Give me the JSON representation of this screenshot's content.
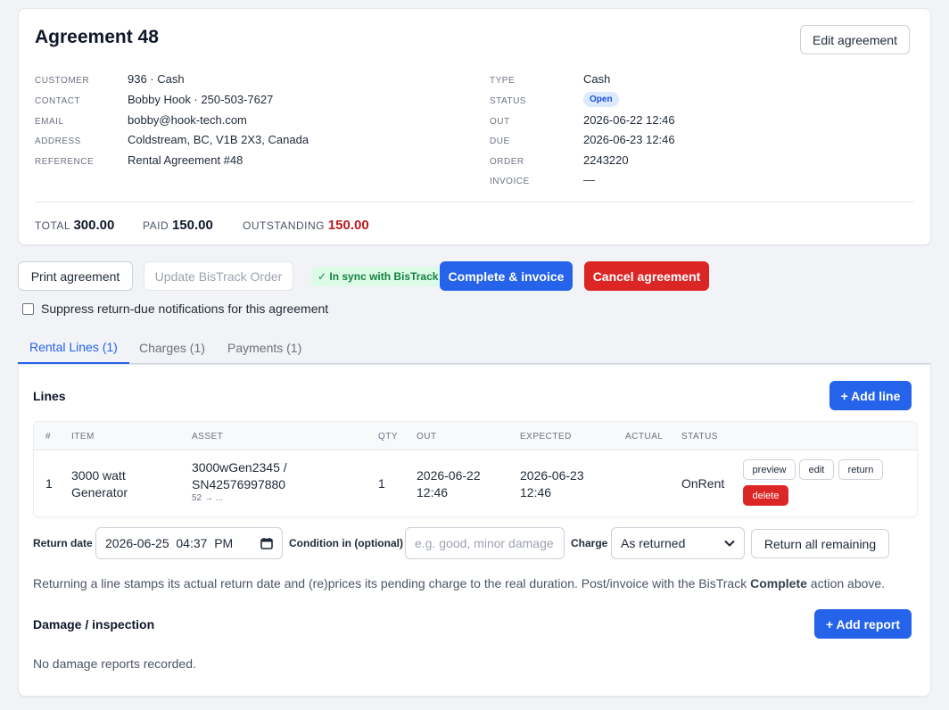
{
  "agreement": {
    "title": "Agreement 48",
    "edit_label": "Edit agreement",
    "left_fields": [
      {
        "label": "CUSTOMER",
        "value": "936 · Cash"
      },
      {
        "label": "CONTACT",
        "value": "Bobby Hook · 250-503-7627"
      },
      {
        "label": "EMAIL",
        "value": "bobby@hook-tech.com"
      },
      {
        "label": "ADDRESS",
        "value": "Coldstream, BC, V1B 2X3, Canada"
      },
      {
        "label": "REFERENCE",
        "value": "Rental Agreement #48"
      }
    ],
    "right_fields": [
      {
        "label": "TYPE",
        "value": "Cash"
      },
      {
        "label": "STATUS",
        "value": "Open"
      },
      {
        "label": "OUT",
        "value": "2026-06-22 12:46"
      },
      {
        "label": "DUE",
        "value": "2026-06-23 12:46"
      },
      {
        "label": "ORDER",
        "value": "2243220"
      },
      {
        "label": "INVOICE",
        "value": "—"
      }
    ],
    "totals": {
      "total_label": "TOTAL",
      "total": "300.00",
      "paid_label": "PAID",
      "paid": "150.00",
      "outstanding_label": "OUTSTANDING",
      "outstanding": "150.00"
    }
  },
  "actions": {
    "print": "Print agreement",
    "update_bistrack": "Update BisTrack Order",
    "sync_status": "✓ In sync with BisTrack",
    "complete": "Complete & invoice",
    "cancel": "Cancel agreement"
  },
  "suppress_label": "Suppress return-due notifications for this agreement",
  "tabs": [
    {
      "label": "Rental Lines (1)",
      "active": true
    },
    {
      "label": "Charges (1)",
      "active": false
    },
    {
      "label": "Payments (1)",
      "active": false
    }
  ],
  "lines": {
    "title": "Lines",
    "add_label": "+ Add line",
    "headers": [
      "#",
      "ITEM",
      "ASSET",
      "QTY",
      "OUT",
      "EXPECTED",
      "ACTUAL",
      "STATUS"
    ],
    "rows": [
      {
        "num": "1",
        "item_line1": "3000 watt",
        "item_line2": "Generator",
        "asset_line1": "3000wGen2345 /",
        "asset_line2": "SN42576997880",
        "asset_sub": "52 → ...",
        "qty": "1",
        "out_line1": "2026-06-22",
        "out_line2": "12:46",
        "expected_line1": "2026-06-23",
        "expected_line2": "12:46",
        "actual": "",
        "status": "OnRent",
        "btn_preview": "preview",
        "btn_edit": "edit",
        "btn_return": "return",
        "btn_delete": "delete"
      }
    ]
  },
  "return_form": {
    "date_label": "Return date",
    "date_value": "2026-06-25  04:37  PM",
    "condition_label": "Condition in (optional)",
    "condition_placeholder": "e.g. good, minor damage",
    "charge_label": "Charge",
    "charge_value": "As returned",
    "return_all": "Return all remaining"
  },
  "note": {
    "before": "Returning a line stamps its actual return date and (re)prices its pending charge to the real duration. Post/invoice with the BisTrack ",
    "bold": "Complete",
    "after": " action above."
  },
  "damage": {
    "title": "Damage / inspection",
    "add_label": "+ Add report",
    "empty": "No damage reports recorded."
  }
}
